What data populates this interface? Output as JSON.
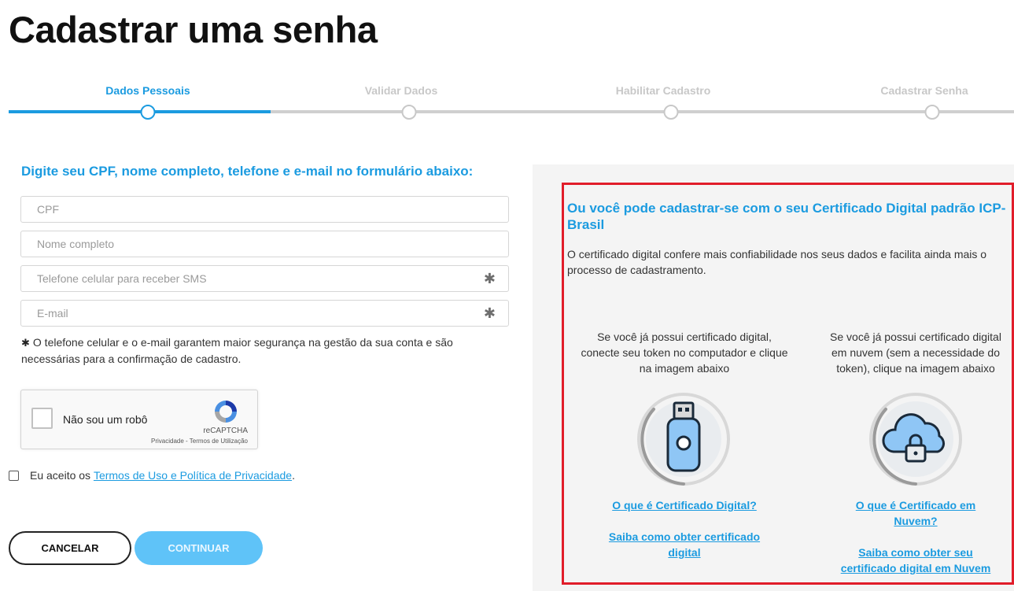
{
  "page": {
    "title": "Cadastrar uma senha"
  },
  "stepper": {
    "steps": [
      {
        "label": "Dados Pessoais"
      },
      {
        "label": "Validar Dados"
      },
      {
        "label": "Habilitar Cadastro"
      },
      {
        "label": "Cadastrar Senha"
      }
    ],
    "active_index": 0
  },
  "form": {
    "heading": "Digite seu CPF, nome completo, telefone e e-mail no formulário abaixo:",
    "cpf_placeholder": "CPF",
    "name_placeholder": "Nome completo",
    "phone_placeholder": "Telefone celular para receber SMS",
    "email_placeholder": "E-mail",
    "required_mark": "✱",
    "note": "O telefone celular e o e-mail garantem maior segurança na gestão da sua conta e são necessárias para a confirmação de cadastro."
  },
  "recaptcha": {
    "label": "Não sou um robô",
    "brand": "reCAPTCHA",
    "links": "Privacidade - Termos de Utilização"
  },
  "terms": {
    "prefix": "Eu aceito os ",
    "link": "Termos de Uso e Política de Privacidade",
    "suffix": "."
  },
  "buttons": {
    "cancel": "CANCELAR",
    "continue": "CONTINUAR"
  },
  "certificate": {
    "heading": "Ou você pode cadastrar-se com o seu Certificado Digital padrão ICP-Brasil",
    "description": "O certificado digital confere mais confiabilidade nos seus dados e facilita ainda mais o processo de cadastramento.",
    "token": {
      "text": "Se você já possui certificado digital, conecte seu token no computador e clique na imagem abaixo",
      "link1": "O que é Certificado Digital?",
      "link2": "Saiba como obter certificado digital"
    },
    "cloud": {
      "text": "Se você já possui certificado digital em nuvem (sem a necessidade do token), clique na imagem abaixo",
      "link1": "O que é Certificado em Nuvem?",
      "link2": "Saiba como obter seu certificado digital em Nuvem"
    }
  },
  "colors": {
    "accent": "#1b9be0",
    "button_light": "#5fc3f8",
    "frame": "#e11d2a"
  }
}
